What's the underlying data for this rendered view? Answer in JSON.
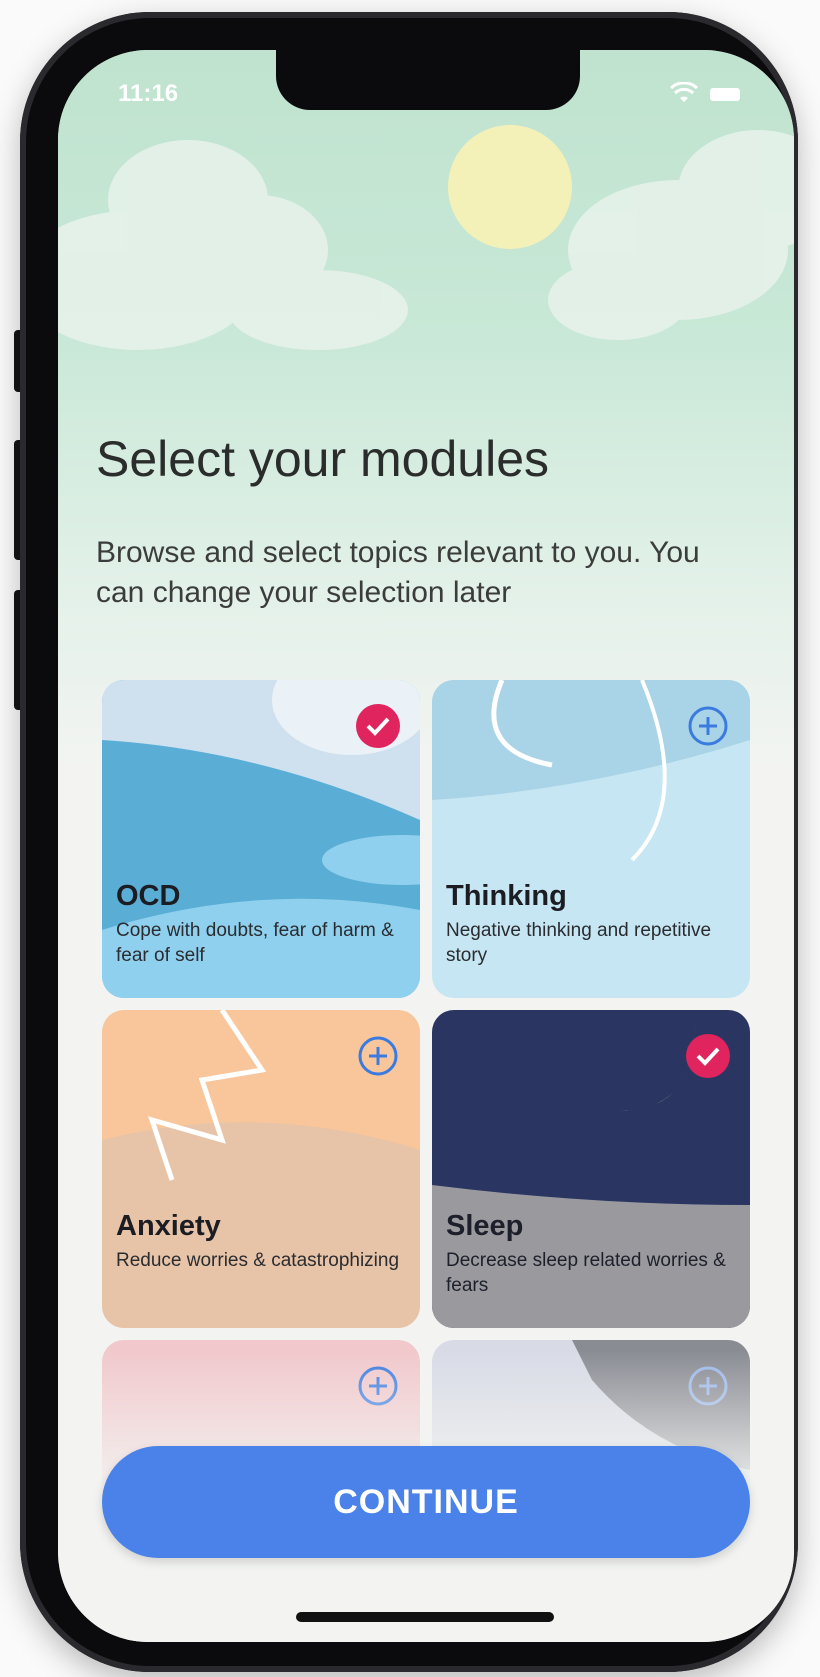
{
  "status_bar": {
    "time": "11:16"
  },
  "header": {
    "title": "Select your modules",
    "subtitle": "Browse and select topics relevant to you. You can change your selection later"
  },
  "modules": [
    {
      "title": "OCD",
      "description": "Cope with doubts, fear of harm & fear of self",
      "selected": true
    },
    {
      "title": "Thinking",
      "description": "Negative thinking and repetitive story",
      "selected": false
    },
    {
      "title": "Anxiety",
      "description": "Reduce worries & catastrophizing",
      "selected": false
    },
    {
      "title": "Sleep",
      "description": "Decrease sleep related worries & fears",
      "selected": true
    },
    {
      "title": "",
      "description": "",
      "selected": false
    },
    {
      "title": "",
      "description": "",
      "selected": false
    }
  ],
  "continue_label": "CONTINUE",
  "colors": {
    "accent": "#4a82ea",
    "selected_badge": "#e0245e",
    "add_icon": "#3b7be0"
  }
}
